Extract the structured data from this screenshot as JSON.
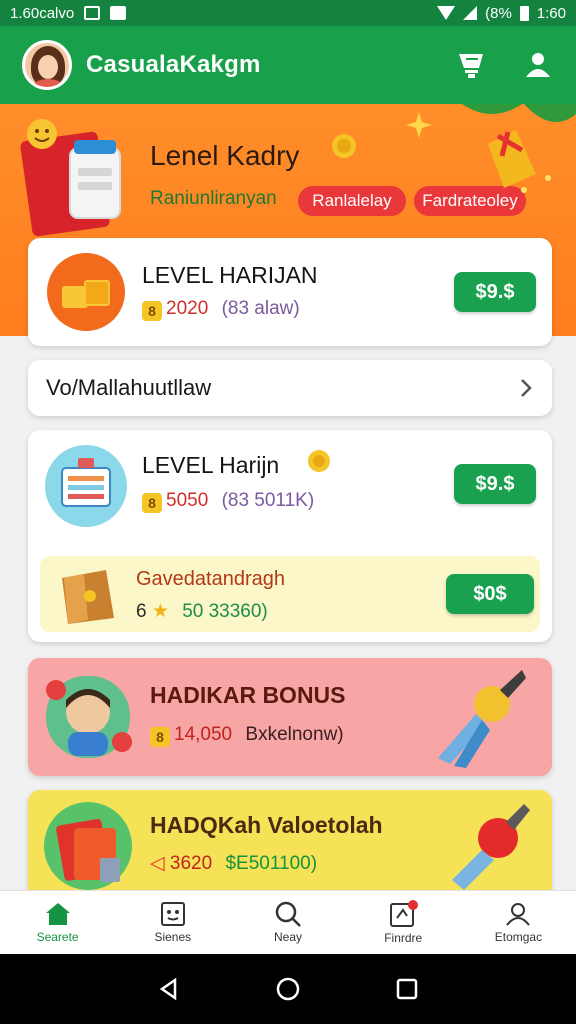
{
  "status_bar": {
    "left_text": "1.60calvo",
    "right_percent": "(8%",
    "time": "1:60"
  },
  "app": {
    "title": "CasualaKakgm"
  },
  "banner": {
    "title": "Lenel Kadry",
    "subtitle": "Raniunliranyan",
    "pill1": "Ranlalelay",
    "pill2": "Fardrateoley"
  },
  "cards": [
    {
      "title": "LEVEL HARIJAN",
      "points": "2020",
      "points_note": "(83 alaw)",
      "price": "$9.$"
    },
    {
      "row_label": "Vo/Mallahuutllaw"
    },
    {
      "title": "LEVEL Harijn",
      "points": "5050",
      "points_note": "(83 5011K)",
      "price": "$9.$",
      "sub_title": "Gavedatandragh",
      "sub_stars": "6",
      "sub_points": "50 33360)",
      "sub_price": "$0$"
    },
    {
      "title": "HADIKAR BONUS",
      "points": "14,050",
      "points_note": "Bxkelnonw)"
    },
    {
      "title": "HADQKah Valoetolah",
      "points": "3620",
      "points_note": "$E501100)"
    }
  ],
  "bottom_nav": [
    {
      "label": "Searete",
      "icon": "home-icon"
    },
    {
      "label": "Sienes",
      "icon": "scan-icon"
    },
    {
      "label": "Neay",
      "icon": "search-icon"
    },
    {
      "label": "Finrdre",
      "icon": "orders-icon"
    },
    {
      "label": "Etomgac",
      "icon": "profile-icon"
    }
  ],
  "colors": {
    "primary": "#18a04a",
    "banner": "#ff8e2a",
    "accent_red": "#e9373a"
  }
}
